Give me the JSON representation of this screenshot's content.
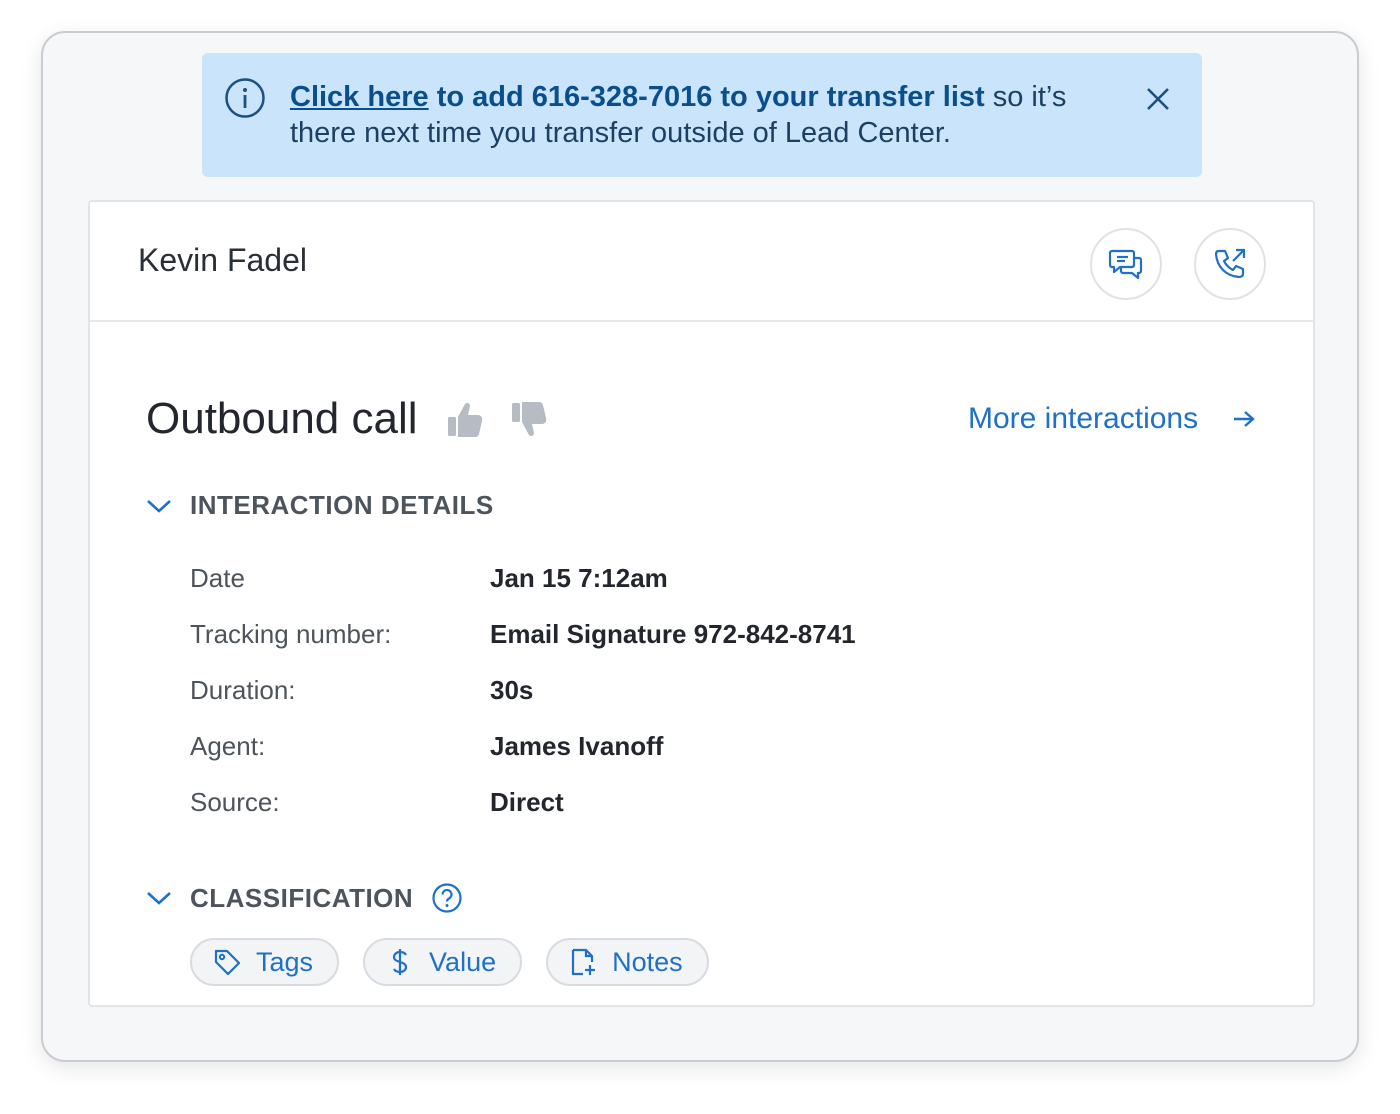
{
  "banner": {
    "link_text": "Click here",
    "bold_text": " to add 616-328-7016 to your transfer list",
    "rest_text": " so it’s there next time you transfer outside of Lead Center."
  },
  "contact": {
    "name": "Kevin Fadel"
  },
  "interaction": {
    "title": "Outbound call",
    "more_link": "More interactions",
    "details_section": {
      "label": "INTERACTION DETAILS",
      "rows": [
        {
          "key": "Date",
          "value": "Jan 15 7:12am"
        },
        {
          "key": "Tracking number:",
          "value": "Email Signature 972-842-8741"
        },
        {
          "key": "Duration:",
          "value": "30s"
        },
        {
          "key": "Agent:",
          "value": "James Ivanoff"
        },
        {
          "key": "Source:",
          "value": "Direct"
        }
      ]
    },
    "classification_section": {
      "label": "CLASSIFICATION",
      "chips": [
        {
          "label": "Tags",
          "icon": "tag-icon"
        },
        {
          "label": "Value",
          "icon": "dollar-icon"
        },
        {
          "label": "Notes",
          "icon": "note-add-icon"
        }
      ]
    }
  },
  "colors": {
    "accent": "#1f70c8",
    "banner_bg": "#c9e4fb",
    "banner_text": "#0a4f8c"
  }
}
